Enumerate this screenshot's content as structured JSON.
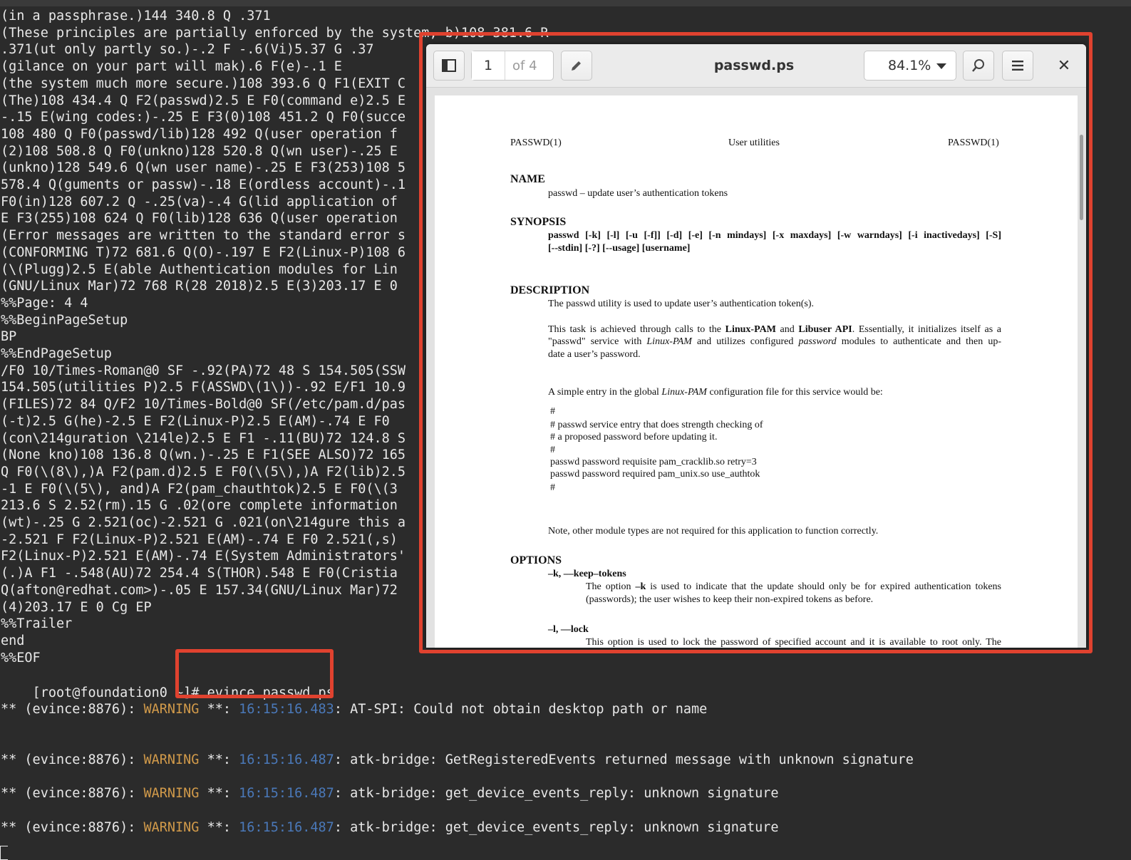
{
  "terminal": {
    "lines": [
      "(in a passphrase.)144 340.8 Q .371",
      "(These principles are partially enforced by the system, b)108 381.6 R",
      ".371(ut only partly so.)-.2 F -.6(Vi)5.37 G .37",
      "(gilance on your part will mak).6 F(e)-.1 E",
      "(the system much more secure.)108 393.6 Q F1(EXIT C",
      "(The)108 434.4 Q F2(passwd)2.5 E F0(command e)2.5 E",
      "-.15 E(wing codes:)-.25 E F3(0)108 451.2 Q F0(succe",
      "108 480 Q F0(passwd/lib)128 492 Q(user operation f",
      "(2)108 508.8 Q F0(unkno)128 520.8 Q(wn user)-.25 E",
      "(unkno)128 549.6 Q(wn user name)-.25 E F3(253)108 5",
      "578.4 Q(guments or passw)-.18 E(ordless account)-.1",
      "F0(in)128 607.2 Q -.25(va)-.4 G(lid application of",
      "E F3(255)108 624 Q F0(lib)128 636 Q(user operation",
      "(Error messages are written to the standard error s",
      "(CONFORMING T)72 681.6 Q(O)-.197 E F2(Linux-P)108 6",
      "(\\(Plugg)2.5 E(able Authentication modules for Lin",
      "(GNU/Linux Mar)72 768 R(28 2018)2.5 E(3)203.17 E 0",
      "%%Page: 4 4",
      "%%BeginPageSetup",
      "BP",
      "%%EndPageSetup",
      "/F0 10/Times-Roman@0 SF -.92(PA)72 48 S 154.505(SSW",
      "154.505(utilities P)2.5 F(ASSWD\\(1\\))-.92 E/F1 10.9",
      "(FILES)72 84 Q/F2 10/Times-Bold@0 SF(/etc/pam.d/pas",
      "(-t)2.5 G(he)-2.5 E F2(Linux-P)2.5 E(AM)-.74 E F0",
      "(con\\214guration \\214le)2.5 E F1 -.11(BU)72 124.8 S",
      "(None kno)108 136.8 Q(wn.)-.25 E F1(SEE ALSO)72 165",
      "Q F0(\\(8\\),)A F2(pam.d)2.5 E F0(\\(5\\),)A F2(lib)2.5",
      "-1 E F0(\\(5\\), and)A F2(pam_chauthtok)2.5 E F0(\\(3",
      "213.6 S 2.52(rm).15 G .02(ore complete information",
      "(wt)-.25 G 2.521(oc)-2.521 G .021(on\\214gure this a",
      "-2.521 F F2(Linux-P)2.521 E(AM)-.74 E F0 2.521(,s)",
      "F2(Linux-P)2.521 E(AM)-.74 E(System Administrators'",
      "(.)A F1 -.548(AU)72 254.4 S(THOR).548 E F0(Cristia",
      "Q(afton@redhat.com>)-.05 E 157.34(GNU/Linux Mar)72",
      "(4)203.17 E 0 Cg EP",
      "%%Trailer",
      "end",
      "%%EOF"
    ],
    "prompt": "[root@foundation0 ~]#",
    "command": "evince passwd.ps",
    "warnings": [
      {
        "prefix": "** (evince:8876): ",
        "level": "WARNING",
        "mid": " **: ",
        "time": "16:15:16.483",
        "msg": ": AT-SPI: Could not obtain desktop path or name"
      },
      {
        "prefix": "** (evince:8876): ",
        "level": "WARNING",
        "mid": " **: ",
        "time": "16:15:16.487",
        "msg": ": atk-bridge: GetRegisteredEvents returned message with unknown signature"
      },
      {
        "prefix": "** (evince:8876): ",
        "level": "WARNING",
        "mid": " **: ",
        "time": "16:15:16.487",
        "msg": ": atk-bridge: get_device_events_reply: unknown signature"
      },
      {
        "prefix": "** (evince:8876): ",
        "level": "WARNING",
        "mid": " **: ",
        "time": "16:15:16.487",
        "msg": ": atk-bridge: get_device_events_reply: unknown signature"
      }
    ]
  },
  "evince": {
    "page_current": "1",
    "page_total": "of 4",
    "title": "passwd.ps",
    "zoom": "84.1%"
  },
  "document": {
    "header_left": "PASSWD(1)",
    "header_center": "User utilities",
    "header_right": "PASSWD(1)",
    "name_heading": "NAME",
    "name_text": "passwd – update user’s authentication tokens",
    "synopsis_heading": "SYNOPSIS",
    "synopsis_line1": "passwd [-k] [-l] [-u [-f]] [-d] [-e] [-n mindays] [-x maxdays] [-w warndays] [-i inactivedays] [-S]",
    "synopsis_line2": "[--stdin] [-?] [--usage] [username]",
    "description_heading": "DESCRIPTION",
    "desc_p1": "The passwd utility is used to update user’s authentication token(s).",
    "desc_p2_a": "This task is achieved through calls to the ",
    "desc_p2_b": "Linux-PAM",
    "desc_p2_c": " and ",
    "desc_p2_d": "Libuser API",
    "desc_p2_e": ".  Essentially, it initializes itself as a",
    "desc_p2_l2_a": "\"passwd\" service with ",
    "desc_p2_l2_b": "Linux-PAM",
    "desc_p2_l2_c": " and utilizes configured ",
    "desc_p2_l2_d": "password",
    "desc_p2_l2_e": " modules to authenticate and then up-",
    "desc_p2_l3": "date a user’s password.",
    "desc_p3_a": "A simple entry in the global ",
    "desc_p3_b": "Linux-PAM",
    "desc_p3_c": " configuration file for this service would be:",
    "code": [
      "#",
      "# passwd service entry that does strength checking of",
      "# a proposed password before updating it.",
      "#",
      "passwd password requisite pam_cracklib.so retry=3",
      "passwd password required pam_unix.so use_authtok",
      "#"
    ],
    "note": "Note, other module types are not required for this application to function correctly.",
    "options_heading": "OPTIONS",
    "opt_k": "–k, ––keep–tokens",
    "opt_k_desc1_a": "The option ",
    "opt_k_desc1_b": "–k",
    "opt_k_desc1_c": " is used to indicate that the update should only be for expired authentication tokens",
    "opt_k_desc2": "(passwords); the user wishes to keep their non-expired tokens as before.",
    "opt_l": "–l, ––lock",
    "opt_l_desc": "This option is used to lock the password of specified account and it is available to root only. The"
  }
}
